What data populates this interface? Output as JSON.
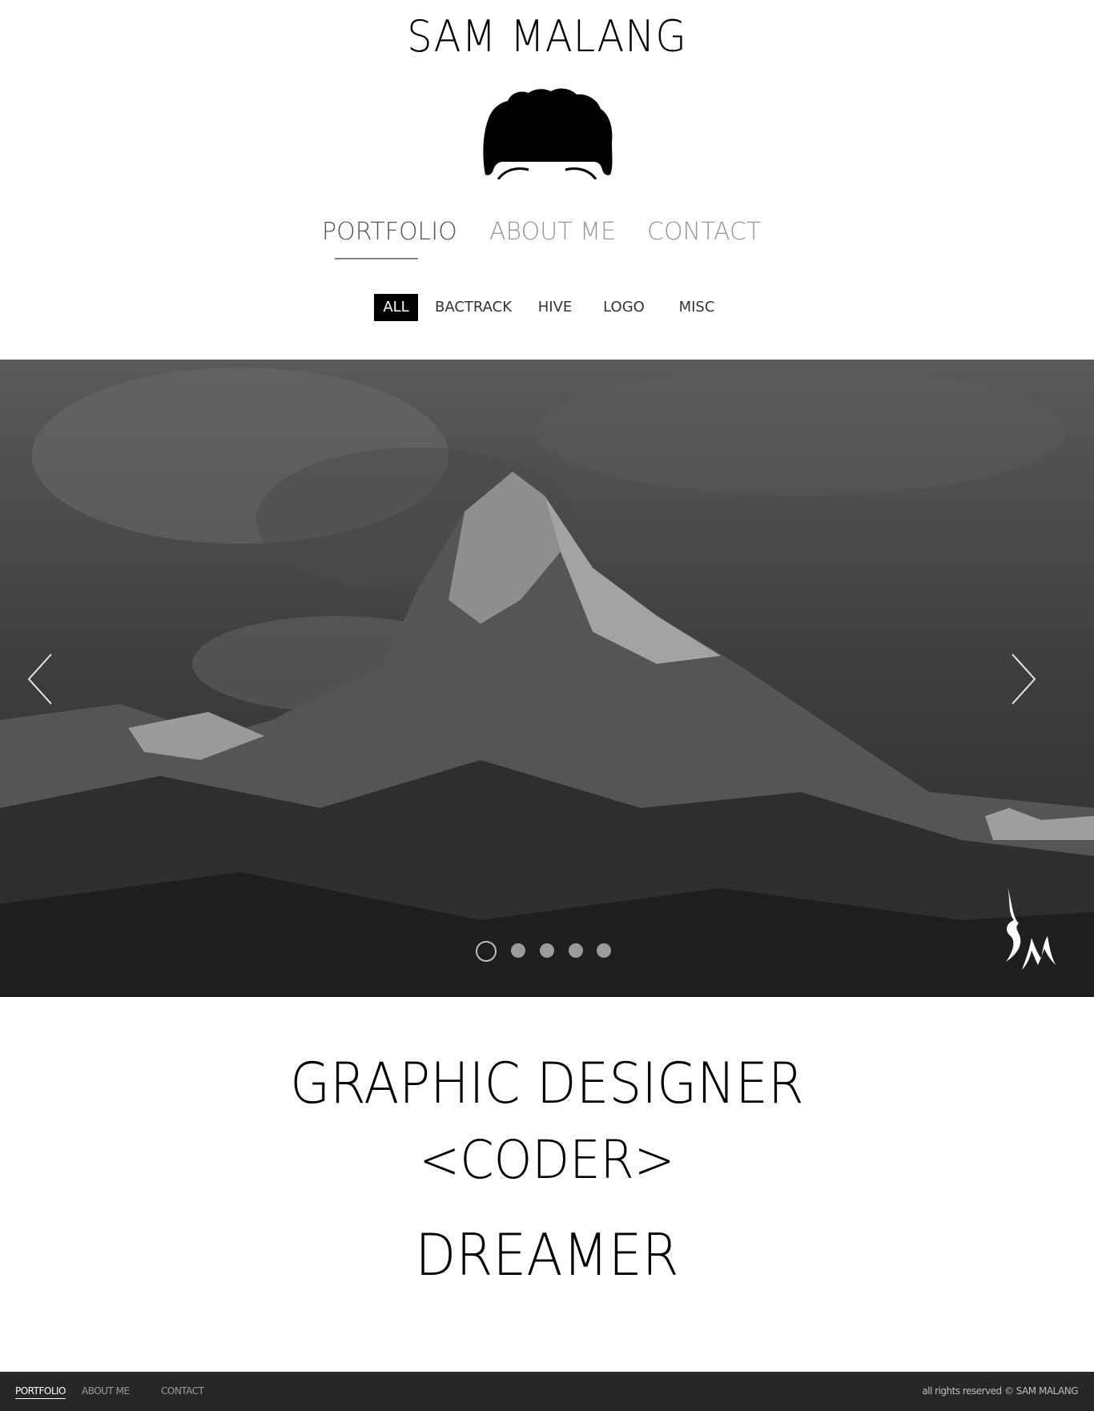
{
  "header": {
    "title": "SAM MALANG"
  },
  "nav": {
    "items": [
      {
        "label": "PORTFOLIO",
        "active": true
      },
      {
        "label": "ABOUT ME",
        "active": false
      },
      {
        "label": "CONTACT",
        "active": false
      }
    ]
  },
  "filters": {
    "items": [
      {
        "label": "ALL",
        "active": true
      },
      {
        "label": "BACTRACK",
        "active": false
      },
      {
        "label": "HIVE",
        "active": false
      },
      {
        "label": "LOGO",
        "active": false
      },
      {
        "label": "MISC",
        "active": false
      }
    ]
  },
  "slider": {
    "slide_count": 5,
    "active_index": 0,
    "prev_icon": "chevron-left-icon",
    "next_icon": "chevron-right-icon"
  },
  "taglines": {
    "line1": "GRAPHIC DESIGNER",
    "line2": "<CODER>",
    "line3": "DREAMER"
  },
  "footer": {
    "items": [
      {
        "label": "PORTFOLIO",
        "active": true
      },
      {
        "label": "ABOUT ME",
        "active": false
      },
      {
        "label": "CONTACT",
        "active": false
      }
    ],
    "copyright": "all rights reserved © SAM MALANG"
  },
  "colors": {
    "footer_bg": "#262626",
    "active_filter_bg": "#000000",
    "nav_inactive": "#9a9696"
  }
}
